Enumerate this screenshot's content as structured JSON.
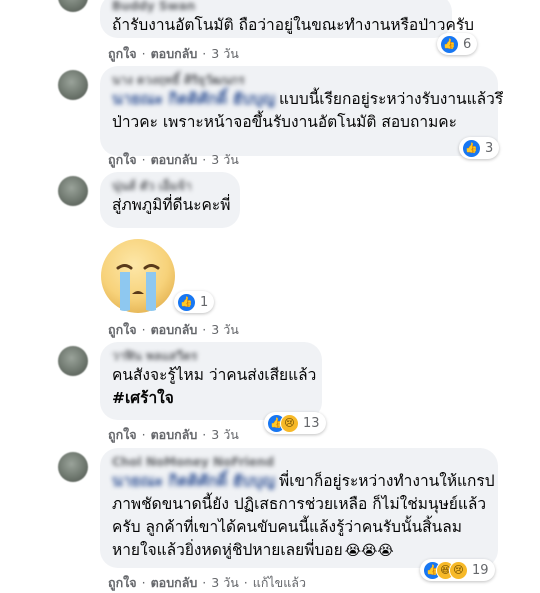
{
  "colors": {
    "bubble": "#f0f2f5",
    "like": "#1877f2",
    "meta_text": "#65676b",
    "text": "#050505"
  },
  "comments": [
    {
      "name": "Buddy Swan",
      "text_lines": [
        "ถ้ารับงานอัตโนมัติ ถือว่าอยู่ในขณะทำงานหรือป่าวครับ"
      ],
      "reactions": {
        "icons": [
          "like-icon"
        ],
        "count": "6"
      },
      "actions": {
        "like": "ถูกใจ",
        "reply": "ตอบกลับ",
        "time": "3 วัน"
      }
    },
    {
      "name": "นาง ดวงฤทธิ์ ศิริยุวัฒนกร",
      "tag": "นายณะ กิตติศักดิ์ ฮับบุญ",
      "text_lines": [
        "แบบนี้เรียกอยู่ระหว่างรับงานแล้วรึ",
        "ป่าวคะ เพราะหน้าจอขึ้นรับงานอัตโนมัติ สอบถามคะ"
      ],
      "reactions": {
        "icons": [
          "like-icon"
        ],
        "count": "3"
      },
      "actions": {
        "like": "ถูกใจ",
        "reply": "ตอบกลับ",
        "time": "3 วัน"
      }
    },
    {
      "name": "นุ่นส์ ตัว เอ็มจ้า",
      "text_lines": [
        "สู่ภพภูมิที่ดีนะคะพี่"
      ],
      "reactions": {
        "icons": [
          "like-icon"
        ],
        "count": "1"
      },
      "sticker": "crying-face-sticker",
      "actions": {
        "like": "ถูกใจ",
        "reply": "ตอบกลับ",
        "time": "3 วัน"
      }
    },
    {
      "name": "วาฬิน พลแสวีดร",
      "text_lines": [
        "คนสังจะรู้ไหม ว่าคนส่งเสียแล้ว"
      ],
      "hashtag": "#เศร้าใจ",
      "reactions": {
        "icons": [
          "like-icon",
          "sad-icon"
        ],
        "count": "13"
      },
      "actions": {
        "like": "ถูกใจ",
        "reply": "ตอบกลับ",
        "time": "3 วัน"
      }
    },
    {
      "name": "Chol NoMoney NoFriend",
      "tag": "นายณะ กิตติศักดิ์ ฮับบุญ",
      "text_lines": [
        "พี่เขาก็อยู่ระหว่างทำงานให้แกรป",
        "ภาพชัดขนาดนี้ยัง ปฏิเสธการช่วยเหลือ ก็ไม่ใช่มนุษย์แล้ว",
        "ครับ ลูกค้าที่เขาได้คนขับคนนี้แล้งรู้ว่าคนรับนั้นสิ้นลม",
        "หายใจแล้วยิ่งหดหู่ชิปหายเลยพี่บอย"
      ],
      "trailing_emoji": "😭😭😭",
      "reactions": {
        "icons": [
          "like-icon",
          "haha-icon",
          "sad-icon"
        ],
        "count": "19"
      },
      "actions": {
        "like": "ถูกใจ",
        "reply": "ตอบกลับ",
        "time": "3 วัน",
        "edited": "แก้ไขแล้ว"
      }
    }
  ]
}
